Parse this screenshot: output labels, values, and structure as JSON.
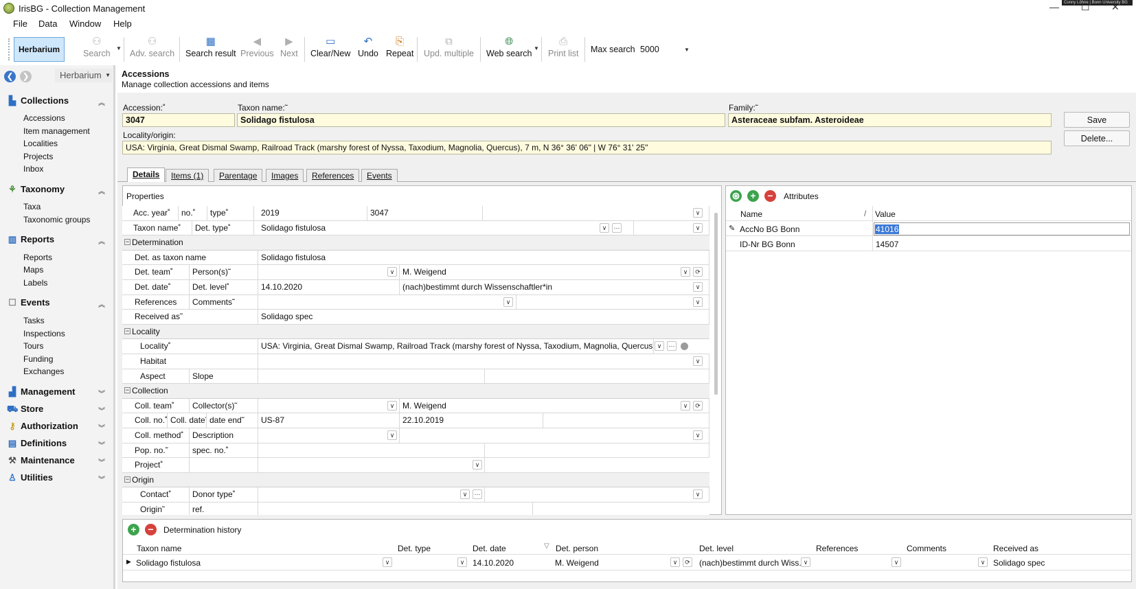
{
  "window": {
    "title": "IrisBG - Collection Management",
    "badge": "Conny Löhne | Bonn University BG",
    "min": "—",
    "max": "☐",
    "close": "✕"
  },
  "menu": [
    "File",
    "Data",
    "Window",
    "Help"
  ],
  "toolbar": {
    "herbarium": "Herbarium",
    "buttons": [
      {
        "label": "Search",
        "icon": "binoculars-icon",
        "enabled": false
      },
      {
        "label": "Adv. search",
        "icon": "binoculars-plus-icon",
        "enabled": false
      },
      {
        "label": "Search result",
        "icon": "table-icon",
        "enabled": true
      },
      {
        "label": "Previous",
        "icon": "arrow-left-circle-icon",
        "enabled": false
      },
      {
        "label": "Next",
        "icon": "arrow-right-circle-icon",
        "enabled": false
      },
      {
        "label": "Clear/New",
        "icon": "blank-page-icon",
        "enabled": true
      },
      {
        "label": "Undo",
        "icon": "undo-icon",
        "enabled": true
      },
      {
        "label": "Repeat",
        "icon": "repeat-icon",
        "enabled": true
      },
      {
        "label": "Upd. multiple",
        "icon": "update-multiple-icon",
        "enabled": false
      },
      {
        "label": "Web search",
        "icon": "globe-icon",
        "enabled": true
      },
      {
        "label": "Print list",
        "icon": "printer-icon",
        "enabled": false
      }
    ],
    "max_search_label": "Max search",
    "max_search_value": "5000"
  },
  "sidebar": {
    "combo": "Herbarium",
    "groups": [
      {
        "label": "Collections",
        "items": [
          "Accessions",
          "Item management",
          "Localities",
          "Projects",
          "Inbox"
        ]
      },
      {
        "label": "Taxonomy",
        "items": [
          "Taxa",
          "Taxonomic groups"
        ]
      },
      {
        "label": "Reports",
        "items": [
          "Reports",
          "Maps",
          "Labels"
        ]
      },
      {
        "label": "Events",
        "items": [
          "Tasks",
          "Inspections",
          "Tours",
          "Funding",
          "Exchanges"
        ]
      },
      {
        "label": "Management",
        "items": []
      },
      {
        "label": "Store",
        "items": []
      },
      {
        "label": "Authorization",
        "items": []
      },
      {
        "label": "Definitions",
        "items": []
      },
      {
        "label": "Maintenance",
        "items": []
      },
      {
        "label": "Utilities",
        "items": []
      }
    ]
  },
  "header": {
    "title": "Accessions",
    "subtitle": "Manage collection accessions and items"
  },
  "form": {
    "accession_label": "Accession:˚",
    "accession": "3047",
    "taxon_label": "Taxon name:˜",
    "taxon": "Solidago fistulosa",
    "family_label": "Family:˜",
    "family": "Asteraceae subfam. Asteroideae",
    "locality_label": "Locality/origin:",
    "locality": "USA: Virginia, Great Dismal Swamp, Railroad Track (marshy forest of Nyssa, Taxodium, Magnolia, Quercus), 7 m, N 36° 36' 06\" | W 76° 31' 25\"",
    "save": "Save",
    "delete": "Delete..."
  },
  "tabs": [
    "Details",
    "Items (1)",
    "Parentage",
    "Images",
    "References",
    "Events"
  ],
  "properties": {
    "title": "Properties",
    "acc_year": "Acc. year˚",
    "no": "no.˚",
    "type": "type˚",
    "year_val": "2019",
    "no_val": "3047",
    "taxon_name": "Taxon name˚",
    "det_type": "Det. type˚",
    "taxon_val": "Solidago fistulosa",
    "sec_det": "Determination",
    "det_as": "Det. as taxon name",
    "det_as_val": "Solidago fistulosa",
    "det_team": "Det. team˚",
    "persons": "Person(s)˜",
    "persons_val": "M. Weigend",
    "det_date": "Det. date˚",
    "det_level": "Det. level˚",
    "det_date_val": "14.10.2020",
    "det_level_val": "(nach)bestimmt durch Wissenschaftler*in",
    "references": "References",
    "comments": "Comments˜",
    "received_as": "Received as˜",
    "received_val": "Solidago spec",
    "sec_loc": "Locality",
    "locality": "Locality˚",
    "locality_val": "USA: Virginia, Great Dismal Swamp, Railroad Track (marshy forest of Nyssa, Taxodium, Magnolia, Quercus), 7 m, N 3...",
    "habitat": "Habitat",
    "aspect": "Aspect",
    "slope": "Slope",
    "sec_coll": "Collection",
    "coll_team": "Coll. team˚",
    "collectors": "Collector(s)˜",
    "collectors_val": "M. Weigend",
    "coll_no": "Coll. no.˚",
    "coll_date": "Coll. date˜",
    "date_end": "date end˜",
    "coll_no_val": "US-87",
    "coll_date_val": "22.10.2019",
    "coll_method": "Coll. method˚",
    "description": "Description",
    "pop_no": "Pop. no.˜",
    "spec_no": "spec. no.˚",
    "project": "Project˚",
    "sec_origin": "Origin",
    "contact": "Contact˚",
    "donor_type": "Donor type˚",
    "origin": "Origin˜",
    "ref": "ref."
  },
  "attributes": {
    "title": "Attributes",
    "col_name": "Name",
    "col_value": "Value",
    "rows": [
      {
        "name": "AccNo BG Bonn",
        "value": "41016"
      },
      {
        "name": "ID-Nr BG Bonn",
        "value": "14507"
      }
    ]
  },
  "history": {
    "title": "Determination history",
    "columns": [
      "Taxon name",
      "Det. type",
      "Det. date",
      "Det. person",
      "Det. level",
      "References",
      "Comments",
      "Received as"
    ],
    "row": [
      "Solidago fistulosa",
      "",
      "14.10.2020",
      "M. Weigend",
      "(nach)bestimmt durch Wiss...",
      "",
      "",
      "Solidago spec"
    ]
  }
}
